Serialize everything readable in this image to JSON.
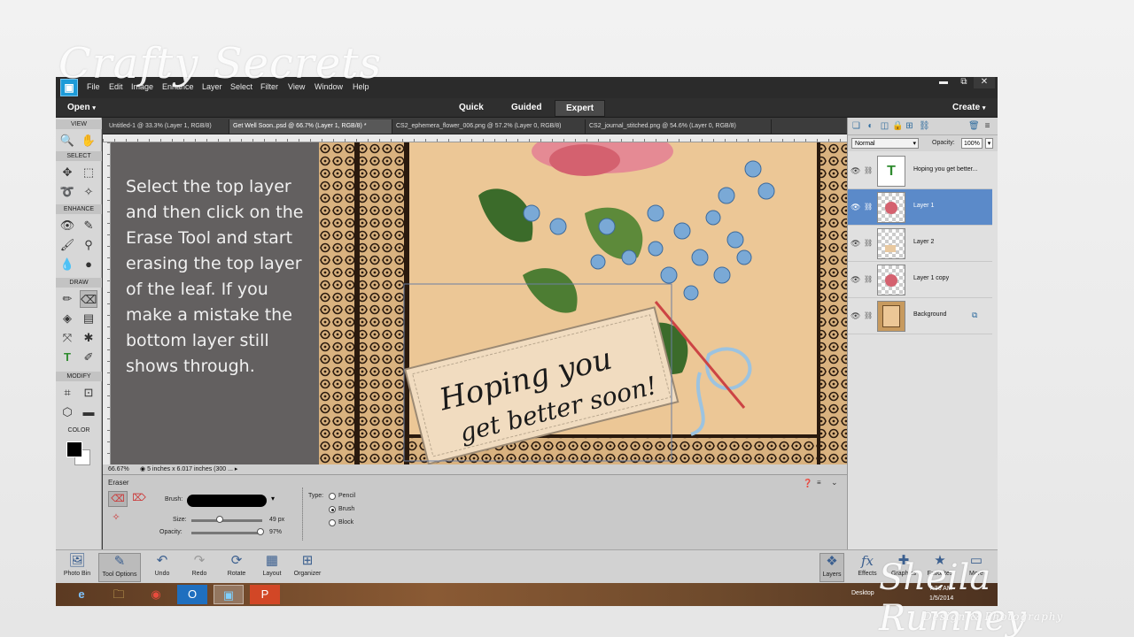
{
  "watermarks": {
    "top": "Crafty Secrets",
    "bottom": "Sheila Rumney",
    "bottom_sub": "Design & Photography"
  },
  "menu": {
    "items": [
      "File",
      "Edit",
      "Image",
      "Enhance",
      "Layer",
      "Select",
      "Filter",
      "View",
      "Window",
      "Help"
    ],
    "window_buttons": [
      "▬",
      "⧉",
      "✕"
    ]
  },
  "modebar": {
    "open": "Open",
    "modes": [
      "Quick",
      "Guided",
      "Expert"
    ],
    "active_mode": "Expert",
    "create": "Create"
  },
  "toolbox": {
    "sections": [
      "VIEW",
      "SELECT",
      "ENHANCE",
      "DRAW",
      "MODIFY",
      "COLOR"
    ]
  },
  "doc_tabs": [
    "Untitled-1 @ 33.3% (Layer 1, RGB/8)",
    "Get Well Soon..psd @ 66.7% (Layer 1, RGB/8) *",
    "CS2_ephemera_flower_006.png @ 57.2% (Layer 0, RGB/8)",
    "CS2_journal_stitched.png @ 54.6% (Layer 0, RGB/8)"
  ],
  "instruction": "Select the top layer and then click on the Erase Tool and start erasing the top layer of the leaf.  If you make a mistake the bottom layer still shows through.",
  "artwork_text": {
    "line1": "Hoping you",
    "line2": "get better soon!"
  },
  "statusbar": {
    "zoom": "66.67%",
    "doc_info": "5 inches x 6.017 inches (300 ..."
  },
  "tool_options": {
    "tool_name": "Eraser",
    "brush_label": "Brush:",
    "size_label": "Size:",
    "size_value": "49 px",
    "size_fraction": 0.4,
    "opacity_label": "Opacity:",
    "opacity_value": "97%",
    "opacity_fraction": 0.97,
    "type_label": "Type:",
    "types": [
      "Pencil",
      "Brush",
      "Block"
    ],
    "selected_type": "Brush"
  },
  "layers": {
    "blend_mode": "Normal",
    "opacity_label": "Opacity:",
    "opacity_value": "100%",
    "rows": [
      {
        "name": "Hoping you get better..."
      },
      {
        "name": "Layer 1"
      },
      {
        "name": "Layer 2"
      },
      {
        "name": "Layer 1 copy"
      },
      {
        "name": "Background"
      }
    ],
    "selected": "Layer 1"
  },
  "bottom_bar": {
    "left": [
      "Photo Bin",
      "Tool Options",
      "Undo",
      "Redo",
      "Rotate",
      "Layout",
      "Organizer"
    ],
    "right": [
      "Layers",
      "Effects",
      "Graphics",
      "Favorites",
      "More"
    ]
  },
  "taskbar": {
    "desktop": "Desktop",
    "time": "7:36 AM",
    "date": "1/5/2014"
  },
  "colors": {
    "accent": "#5b8ac9",
    "app_dark": "#2b2b2b",
    "instruction_bg": "#636060",
    "parchment": "#e9c9a0"
  }
}
